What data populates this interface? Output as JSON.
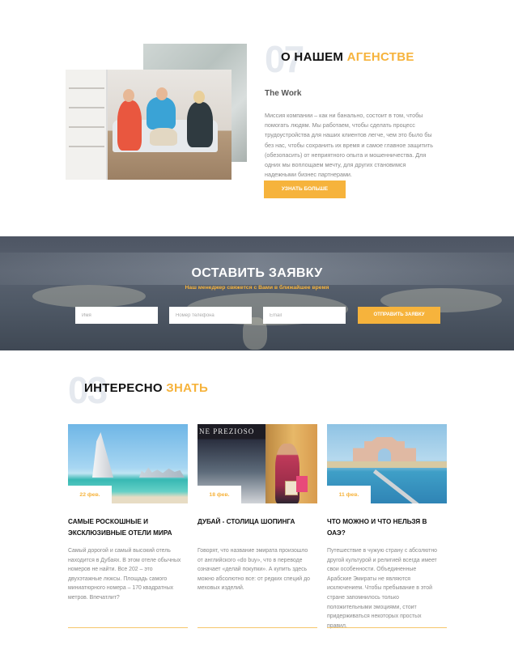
{
  "about": {
    "number": "07",
    "title_main": "О НАШЕМ",
    "title_accent": "АГЕНСТВЕ",
    "subtitle": "The Work",
    "text": "Миссия компании – как ни банально, состоит в том, чтобы помогать людям. Мы работаем, чтобы сделать процесс трудоустройства для наших клиентов легче, чем это было бы без нас, чтобы сохранить их время и самое главное защитить (обезопасить) от неприятного опыта и мошенничества. Для одних мы воплощаем мечту, для других становимся надежными бизнес партнерами.",
    "button": "Узнать больше"
  },
  "request": {
    "title": "ОСТАВИТЬ ЗАЯВКУ",
    "subtitle": "Наш менеджер свяжется с Вами в ближайшее время",
    "name_placeholder": "Имя",
    "phone_placeholder": "Номер телефона",
    "email_placeholder": "Email",
    "submit": "Отправить заявку"
  },
  "interesting": {
    "number": "03",
    "title_main": "ИНТЕРЕСНО",
    "title_accent": "ЗНАТЬ",
    "cards": [
      {
        "date": "22 фев.",
        "title": "Самые роскошные и эксклюзивные отели мира",
        "text": "Самый дорогой и самый высокий отель находится в Дубаях. В этом отеле обычных номеров не найти. Все 202 – это двухэтажные люксы. Площадь самого миниатюрного номера – 170 квадратных метров. Впечатлит?"
      },
      {
        "date": "18 фев.",
        "title": "Дубай - столица шопинга",
        "text": "Говорят, что название эмирата произошло от английского «do buy», что в переводе означает «делай покупки». А купить здесь можно абсолютно все: от редких специй до меховых изделий.",
        "image_sign": "NE PREZIOSO"
      },
      {
        "date": "11 фев.",
        "title": "Что можно и что нельзя в ОАЭ?",
        "text": "Путешествие в чужую страну с абсолютно другой культурой и религией всегда имеет свои особенности. Объединенные Арабские Эмираты не являются исключением. Чтобы пребывание в этой стране запомнилось только положительными эмоциями, стоит придерживаться некоторых простых правил."
      }
    ]
  },
  "colors": {
    "accent": "#f6b33c",
    "heading": "#111111",
    "body_text": "#888888",
    "banner_overlay": "#4d5563"
  }
}
